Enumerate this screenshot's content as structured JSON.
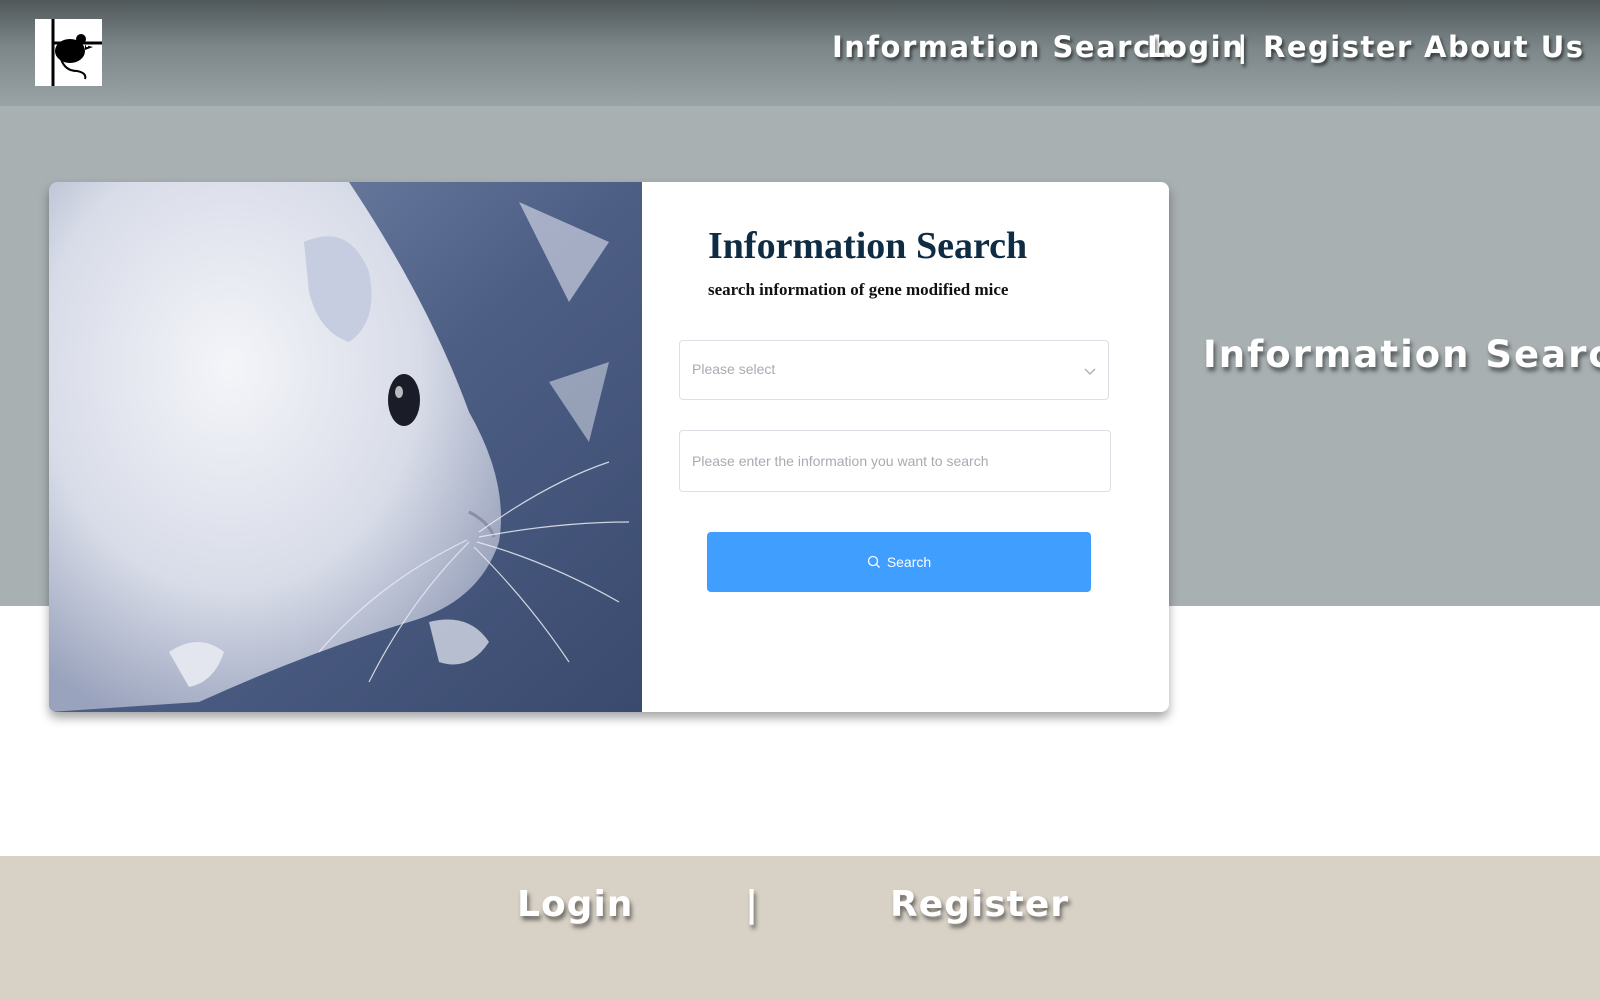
{
  "header": {
    "logo_icon": "mouse-logo-icon",
    "nav": {
      "information_search": "Information Search",
      "login": "Login",
      "separator": "|",
      "register": "Register",
      "about_us": "About Us"
    }
  },
  "hero": {
    "side_title": "Information Search"
  },
  "search_card": {
    "image_icon": "white-mouse-photo",
    "title": "Information Search",
    "subtitle": "search information of gene modified mice",
    "select_placeholder": "Please select",
    "input_placeholder": "Please enter the information you want to search",
    "search_button_label": "Search",
    "search_icon": "search-icon"
  },
  "footer": {
    "login": "Login",
    "separator": "|",
    "register": "Register"
  },
  "colors": {
    "button_primary": "#409eff",
    "title_color": "#0f2c45",
    "hero_bg": "#a8b0b2",
    "footer_bg": "#d8d1c6"
  }
}
